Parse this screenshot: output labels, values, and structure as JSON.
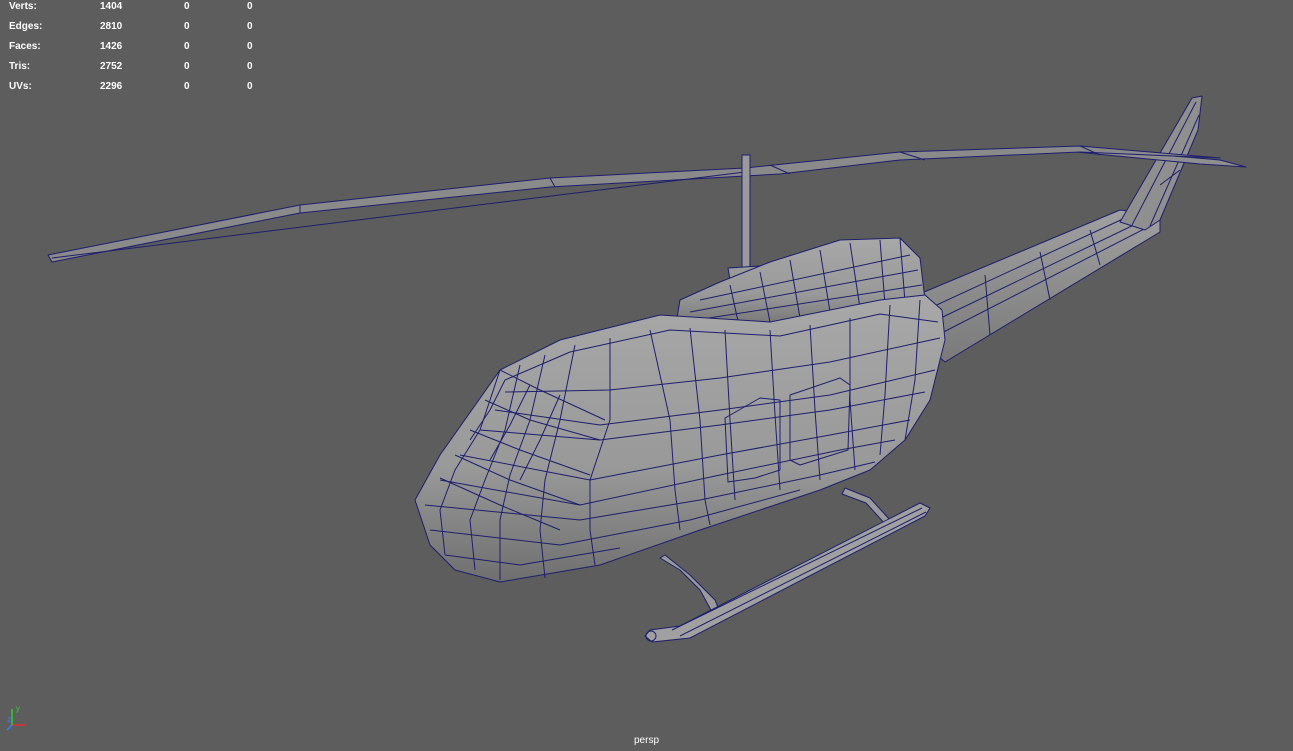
{
  "hud": {
    "rows": [
      {
        "label": "Verts:",
        "values": [
          "1404",
          "0",
          "0"
        ]
      },
      {
        "label": "Edges:",
        "values": [
          "2810",
          "0",
          "0"
        ]
      },
      {
        "label": "Faces:",
        "values": [
          "1426",
          "0",
          "0"
        ]
      },
      {
        "label": "Tris:",
        "values": [
          "2752",
          "0",
          "0"
        ]
      },
      {
        "label": "UVs:",
        "values": [
          "2296",
          "0",
          "0"
        ]
      }
    ]
  },
  "viewport": {
    "camera": "persp",
    "background_color": "#5d5d5d",
    "wire_color": "#1e1e6e",
    "shade_color": "#9a9a9a"
  },
  "axis": {
    "x_label": "x",
    "y_label": "y",
    "z_label": "z",
    "x_color": "#e03030",
    "y_color": "#30d030",
    "z_color": "#3080ff"
  }
}
